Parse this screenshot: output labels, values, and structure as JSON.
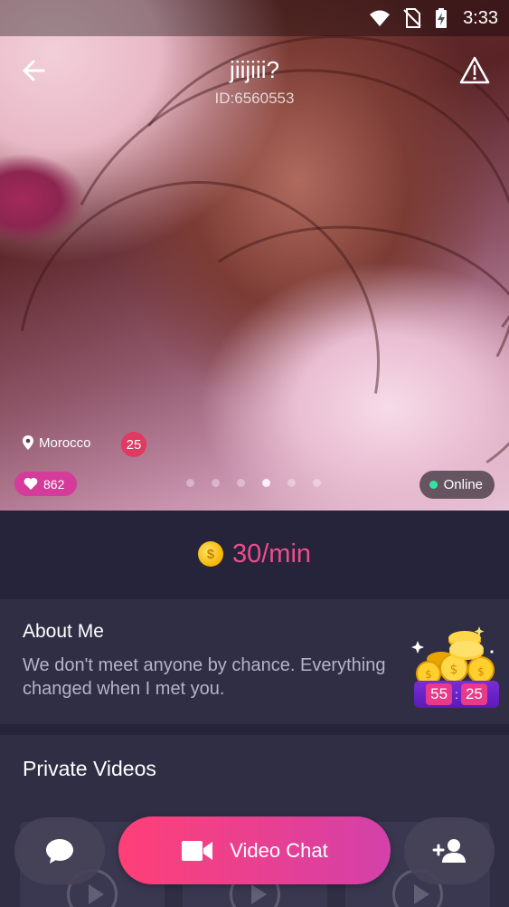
{
  "status_bar": {
    "time": "3:33"
  },
  "header": {
    "title": "jiijiii?",
    "user_id": "ID:6560553"
  },
  "profile": {
    "location": "Morocco",
    "age": "25",
    "likes": "862",
    "status": "Online",
    "photo_pages": 6,
    "active_page": 4
  },
  "price": {
    "text": "30/min"
  },
  "about": {
    "title": "About Me",
    "text_line1": "We don't meet anyone by chance. Everything",
    "text_line2": "changed when I met you."
  },
  "promo": {
    "timer_minutes": "55",
    "timer_seconds": "25",
    "separator": ":"
  },
  "videos": {
    "title": "Private Videos",
    "count": 3
  },
  "actions": {
    "video_chat_label": "Video Chat"
  },
  "icons": {
    "back": "arrow-left-icon",
    "report": "warning-icon",
    "location": "location-pin-icon",
    "likes": "heart-icon",
    "coin": "coin-icon",
    "chat": "chat-bubble-icon",
    "video": "video-camera-icon",
    "follow": "add-user-icon"
  },
  "colors": {
    "accent_pink": "#ee4d8c",
    "background": "#26243a",
    "card": "#302e45",
    "online": "#2ee6a3",
    "age_badge": "#e03a63",
    "likes_badge": "#d43b9b"
  }
}
